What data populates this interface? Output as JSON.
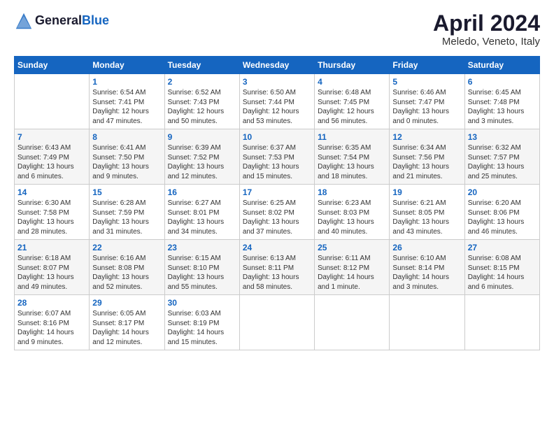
{
  "header": {
    "logo_line1": "General",
    "logo_line2": "Blue",
    "month": "April 2024",
    "location": "Meledo, Veneto, Italy"
  },
  "days_of_week": [
    "Sunday",
    "Monday",
    "Tuesday",
    "Wednesday",
    "Thursday",
    "Friday",
    "Saturday"
  ],
  "weeks": [
    [
      {
        "day": "",
        "sunrise": "",
        "sunset": "",
        "daylight": ""
      },
      {
        "day": "1",
        "sunrise": "Sunrise: 6:54 AM",
        "sunset": "Sunset: 7:41 PM",
        "daylight": "Daylight: 12 hours and 47 minutes."
      },
      {
        "day": "2",
        "sunrise": "Sunrise: 6:52 AM",
        "sunset": "Sunset: 7:43 PM",
        "daylight": "Daylight: 12 hours and 50 minutes."
      },
      {
        "day": "3",
        "sunrise": "Sunrise: 6:50 AM",
        "sunset": "Sunset: 7:44 PM",
        "daylight": "Daylight: 12 hours and 53 minutes."
      },
      {
        "day": "4",
        "sunrise": "Sunrise: 6:48 AM",
        "sunset": "Sunset: 7:45 PM",
        "daylight": "Daylight: 12 hours and 56 minutes."
      },
      {
        "day": "5",
        "sunrise": "Sunrise: 6:46 AM",
        "sunset": "Sunset: 7:47 PM",
        "daylight": "Daylight: 13 hours and 0 minutes."
      },
      {
        "day": "6",
        "sunrise": "Sunrise: 6:45 AM",
        "sunset": "Sunset: 7:48 PM",
        "daylight": "Daylight: 13 hours and 3 minutes."
      }
    ],
    [
      {
        "day": "7",
        "sunrise": "Sunrise: 6:43 AM",
        "sunset": "Sunset: 7:49 PM",
        "daylight": "Daylight: 13 hours and 6 minutes."
      },
      {
        "day": "8",
        "sunrise": "Sunrise: 6:41 AM",
        "sunset": "Sunset: 7:50 PM",
        "daylight": "Daylight: 13 hours and 9 minutes."
      },
      {
        "day": "9",
        "sunrise": "Sunrise: 6:39 AM",
        "sunset": "Sunset: 7:52 PM",
        "daylight": "Daylight: 13 hours and 12 minutes."
      },
      {
        "day": "10",
        "sunrise": "Sunrise: 6:37 AM",
        "sunset": "Sunset: 7:53 PM",
        "daylight": "Daylight: 13 hours and 15 minutes."
      },
      {
        "day": "11",
        "sunrise": "Sunrise: 6:35 AM",
        "sunset": "Sunset: 7:54 PM",
        "daylight": "Daylight: 13 hours and 18 minutes."
      },
      {
        "day": "12",
        "sunrise": "Sunrise: 6:34 AM",
        "sunset": "Sunset: 7:56 PM",
        "daylight": "Daylight: 13 hours and 21 minutes."
      },
      {
        "day": "13",
        "sunrise": "Sunrise: 6:32 AM",
        "sunset": "Sunset: 7:57 PM",
        "daylight": "Daylight: 13 hours and 25 minutes."
      }
    ],
    [
      {
        "day": "14",
        "sunrise": "Sunrise: 6:30 AM",
        "sunset": "Sunset: 7:58 PM",
        "daylight": "Daylight: 13 hours and 28 minutes."
      },
      {
        "day": "15",
        "sunrise": "Sunrise: 6:28 AM",
        "sunset": "Sunset: 7:59 PM",
        "daylight": "Daylight: 13 hours and 31 minutes."
      },
      {
        "day": "16",
        "sunrise": "Sunrise: 6:27 AM",
        "sunset": "Sunset: 8:01 PM",
        "daylight": "Daylight: 13 hours and 34 minutes."
      },
      {
        "day": "17",
        "sunrise": "Sunrise: 6:25 AM",
        "sunset": "Sunset: 8:02 PM",
        "daylight": "Daylight: 13 hours and 37 minutes."
      },
      {
        "day": "18",
        "sunrise": "Sunrise: 6:23 AM",
        "sunset": "Sunset: 8:03 PM",
        "daylight": "Daylight: 13 hours and 40 minutes."
      },
      {
        "day": "19",
        "sunrise": "Sunrise: 6:21 AM",
        "sunset": "Sunset: 8:05 PM",
        "daylight": "Daylight: 13 hours and 43 minutes."
      },
      {
        "day": "20",
        "sunrise": "Sunrise: 6:20 AM",
        "sunset": "Sunset: 8:06 PM",
        "daylight": "Daylight: 13 hours and 46 minutes."
      }
    ],
    [
      {
        "day": "21",
        "sunrise": "Sunrise: 6:18 AM",
        "sunset": "Sunset: 8:07 PM",
        "daylight": "Daylight: 13 hours and 49 minutes."
      },
      {
        "day": "22",
        "sunrise": "Sunrise: 6:16 AM",
        "sunset": "Sunset: 8:08 PM",
        "daylight": "Daylight: 13 hours and 52 minutes."
      },
      {
        "day": "23",
        "sunrise": "Sunrise: 6:15 AM",
        "sunset": "Sunset: 8:10 PM",
        "daylight": "Daylight: 13 hours and 55 minutes."
      },
      {
        "day": "24",
        "sunrise": "Sunrise: 6:13 AM",
        "sunset": "Sunset: 8:11 PM",
        "daylight": "Daylight: 13 hours and 58 minutes."
      },
      {
        "day": "25",
        "sunrise": "Sunrise: 6:11 AM",
        "sunset": "Sunset: 8:12 PM",
        "daylight": "Daylight: 14 hours and 1 minute."
      },
      {
        "day": "26",
        "sunrise": "Sunrise: 6:10 AM",
        "sunset": "Sunset: 8:14 PM",
        "daylight": "Daylight: 14 hours and 3 minutes."
      },
      {
        "day": "27",
        "sunrise": "Sunrise: 6:08 AM",
        "sunset": "Sunset: 8:15 PM",
        "daylight": "Daylight: 14 hours and 6 minutes."
      }
    ],
    [
      {
        "day": "28",
        "sunrise": "Sunrise: 6:07 AM",
        "sunset": "Sunset: 8:16 PM",
        "daylight": "Daylight: 14 hours and 9 minutes."
      },
      {
        "day": "29",
        "sunrise": "Sunrise: 6:05 AM",
        "sunset": "Sunset: 8:17 PM",
        "daylight": "Daylight: 14 hours and 12 minutes."
      },
      {
        "day": "30",
        "sunrise": "Sunrise: 6:03 AM",
        "sunset": "Sunset: 8:19 PM",
        "daylight": "Daylight: 14 hours and 15 minutes."
      },
      {
        "day": "",
        "sunrise": "",
        "sunset": "",
        "daylight": ""
      },
      {
        "day": "",
        "sunrise": "",
        "sunset": "",
        "daylight": ""
      },
      {
        "day": "",
        "sunrise": "",
        "sunset": "",
        "daylight": ""
      },
      {
        "day": "",
        "sunrise": "",
        "sunset": "",
        "daylight": ""
      }
    ]
  ]
}
